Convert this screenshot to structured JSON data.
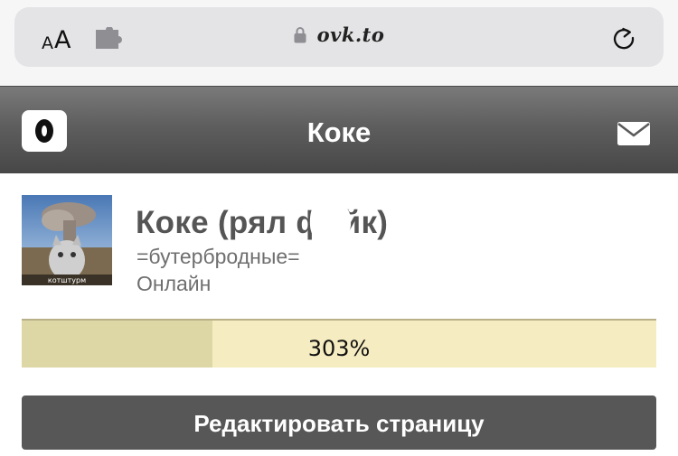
{
  "browser": {
    "aa_small": "A",
    "aa_large": "A",
    "url": "ovk.to",
    "icons": {
      "text_size": "text-size-icon",
      "extension": "puzzle-icon",
      "lock": "lock-icon",
      "reload": "reload-icon"
    }
  },
  "header": {
    "title": "Коке",
    "logo_icon": "openvk-logo-icon",
    "mail_icon": "envelope-icon",
    "background": "#5e5e5e"
  },
  "profile": {
    "name": "Коке (рял фейк)",
    "status": "=бутербродные=",
    "online": "Онлайн",
    "avatar_caption": "котштурм"
  },
  "progress": {
    "label": "303%",
    "fill_fraction": 0.3,
    "track_color": "#f6ecc1",
    "fill_color": "#ddd6a5"
  },
  "actions": {
    "edit_label": "Редактировать страницу"
  }
}
